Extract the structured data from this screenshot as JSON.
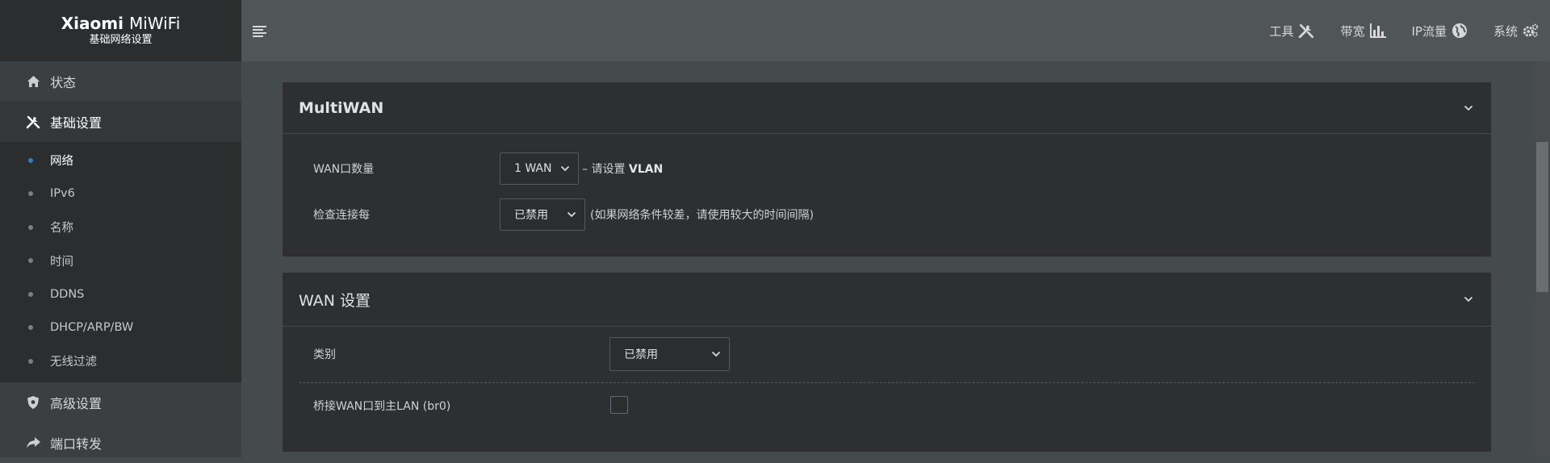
{
  "brand": {
    "title_bold": "Xiaomi",
    "title_light": "MiWiFi",
    "subtitle": "基础网络设置"
  },
  "topbar": {
    "items": [
      {
        "label": "工具",
        "icon": "tools-icon"
      },
      {
        "label": "带宽",
        "icon": "bar-chart-icon"
      },
      {
        "label": "IP流量",
        "icon": "globe-icon"
      },
      {
        "label": "系统",
        "icon": "gears-icon"
      }
    ]
  },
  "sidebar": {
    "main": [
      {
        "label": "状态",
        "icon": "home-icon"
      },
      {
        "label": "基础设置",
        "icon": "tools-icon",
        "active": true
      },
      {
        "label": "高级设置",
        "icon": "shield-icon"
      },
      {
        "label": "端口转发",
        "icon": "share-arrow-icon"
      }
    ],
    "sub": [
      {
        "label": "网络",
        "active": true
      },
      {
        "label": "IPv6"
      },
      {
        "label": "名称"
      },
      {
        "label": "时间"
      },
      {
        "label": "DDNS"
      },
      {
        "label": "DHCP/ARP/BW"
      },
      {
        "label": "无线过滤"
      }
    ]
  },
  "multiwan": {
    "title": "MultiWAN",
    "wan_count": {
      "label": "WAN口数量",
      "value": "1 WAN",
      "hint_prefix": "– 请设置 ",
      "hint_bold": "VLAN"
    },
    "check": {
      "label": "检查连接每",
      "value": "已禁用",
      "hint": "(如果网络条件较差，请使用较大的时间间隔)"
    }
  },
  "wan": {
    "title": "WAN 设置",
    "type": {
      "label": "类别",
      "value": "已禁用"
    },
    "bridge": {
      "label": "桥接WAN口到主LAN (br0)",
      "checked": false
    }
  },
  "colors": {
    "accent_dot": "#2f7fbf",
    "sidebar_bg": "#3b3f42",
    "panel_bg": "#2d2f31"
  }
}
